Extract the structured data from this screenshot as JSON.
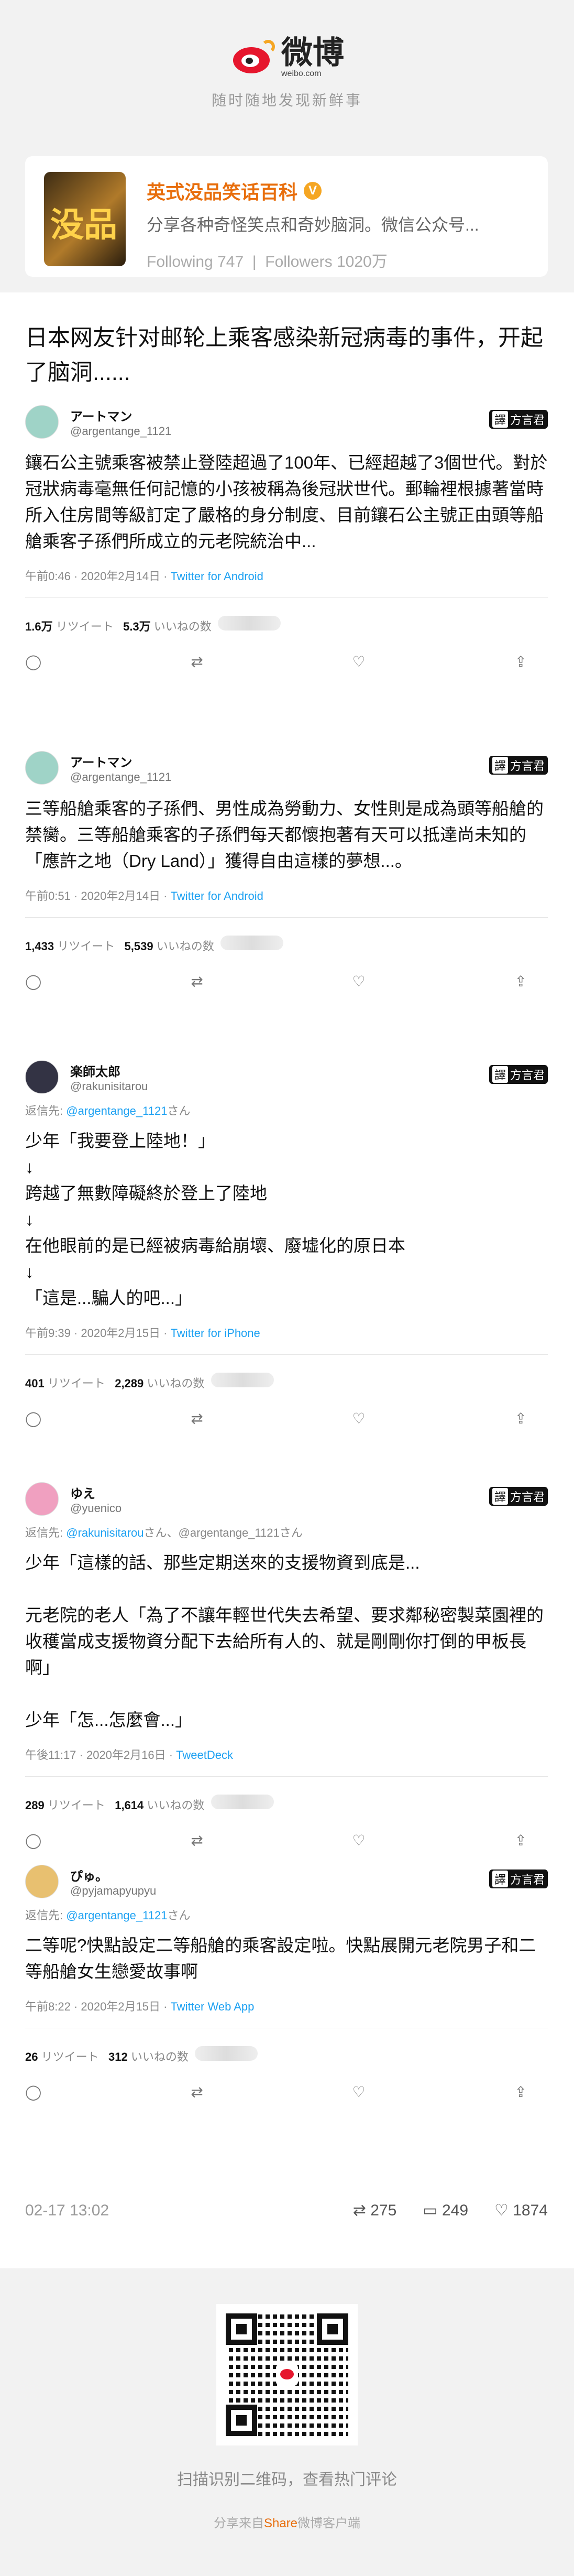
{
  "header": {
    "brand": "微博",
    "url": "weibo.com",
    "tagline": "随时随地发现新鲜事"
  },
  "card": {
    "avatar_text": "没品",
    "name": "英式没品笑话百科",
    "verified": "V",
    "desc": "分享各种奇怪笑点和奇妙脑洞。微信公众号...",
    "following_label": "Following",
    "following": "747",
    "followers_label": "Followers",
    "followers": "1020万"
  },
  "post": {
    "title": "日本网友针对邮轮上乘客感染新冠病毒的事件，开起了脑洞......"
  },
  "translator": {
    "mark": "譯",
    "name": "方言君"
  },
  "tweets": [
    {
      "name": "アートマン",
      "id": "@argentange_1121",
      "reply_prefix": "",
      "reply_to": "",
      "reply_suffix": "",
      "body": "鑲石公主號乘客被禁止登陸超過了100年、已經超越了3個世代。對於冠狀病毒毫無任何記憶的小孩被稱為後冠狀世代。郵輪裡根據著當時所入住房間等級訂定了嚴格的身分制度、目前鑲石公主號正由頭等船艙乘客子孫們所成立的元老院統治中...",
      "time": "午前0:46 · 2020年2月14日 · ",
      "via": "Twitter for Android",
      "rt": "1.6万",
      "rt_label": "リツイート",
      "likes": "5.3万",
      "likes_label": "いいねの数"
    },
    {
      "name": "アートマン",
      "id": "@argentange_1121",
      "reply_prefix": "",
      "reply_to": "",
      "reply_suffix": "",
      "body": "三等船艙乘客的子孫們、男性成為勞動力、女性則是成為頭等船艙的禁臠。三等船艙乘客的子孫們每天都懷抱著有天可以抵達尚未知的「應許之地（Dry Land）」獲得自由這樣的夢想...。",
      "time": "午前0:51 · 2020年2月14日 · ",
      "via": "Twitter for Android",
      "rt": "1,433",
      "rt_label": "リツイート",
      "likes": "5,539",
      "likes_label": "いいねの数"
    },
    {
      "name": "楽師太郎",
      "id": "@rakunisitarou",
      "reply_prefix": "返信先: ",
      "reply_to": "@argentange_1121",
      "reply_suffix": "さん",
      "body": "少年「我要登上陸地！」\n↓\n跨越了無數障礙終於登上了陸地\n↓\n在他眼前的是已經被病毒給崩壞、廢墟化的原日本\n↓\n「這是...騙人的吧...」",
      "time": "午前9:39 · 2020年2月15日 · ",
      "via": "Twitter for iPhone",
      "rt": "401",
      "rt_label": "リツイート",
      "likes": "2,289",
      "likes_label": "いいねの数"
    },
    {
      "name": "ゆえ",
      "id": "@yuenico",
      "reply_prefix": "返信先: ",
      "reply_to": "@rakunisitarou",
      "reply_suffix": "さん、@argentange_1121さん",
      "body": "少年「這樣的話、那些定期送來的支援物資到底是...\n\n元老院的老人「為了不讓年輕世代失去希望、要求鄰秘密製菜園裡的收穫當成支援物資分配下去給所有人的、就是剛剛你打倒的甲板長啊」\n\n少年「怎...怎麼會...」",
      "time": "午後11:17 · 2020年2月16日 · ",
      "via": "TweetDeck",
      "rt": "289",
      "rt_label": "リツイート",
      "likes": "1,614",
      "likes_label": "いいねの数"
    },
    {
      "name": "ぴゅ。",
      "id": "@pyjamapyupyu",
      "reply_prefix": "返信先: ",
      "reply_to": "@argentange_1121",
      "reply_suffix": "さん",
      "body": "二等呢?快點設定二等船艙的乘客設定啦。快點展開元老院男子和二等船艙女生戀愛故事啊",
      "time": "午前8:22 · 2020年2月15日 · ",
      "via": "Twitter Web App",
      "rt": "26",
      "rt_label": "リツイート",
      "likes": "312",
      "likes_label": "いいねの数"
    }
  ],
  "footer": {
    "date": "02-17 13:02",
    "reposts": "275",
    "comments": "249",
    "likes": "1874"
  },
  "qr": {
    "text": "扫描识别二维码，查看热门评论",
    "share_prefix": "分享来自",
    "share_app": "Share",
    "share_suffix": "微博客户端"
  }
}
